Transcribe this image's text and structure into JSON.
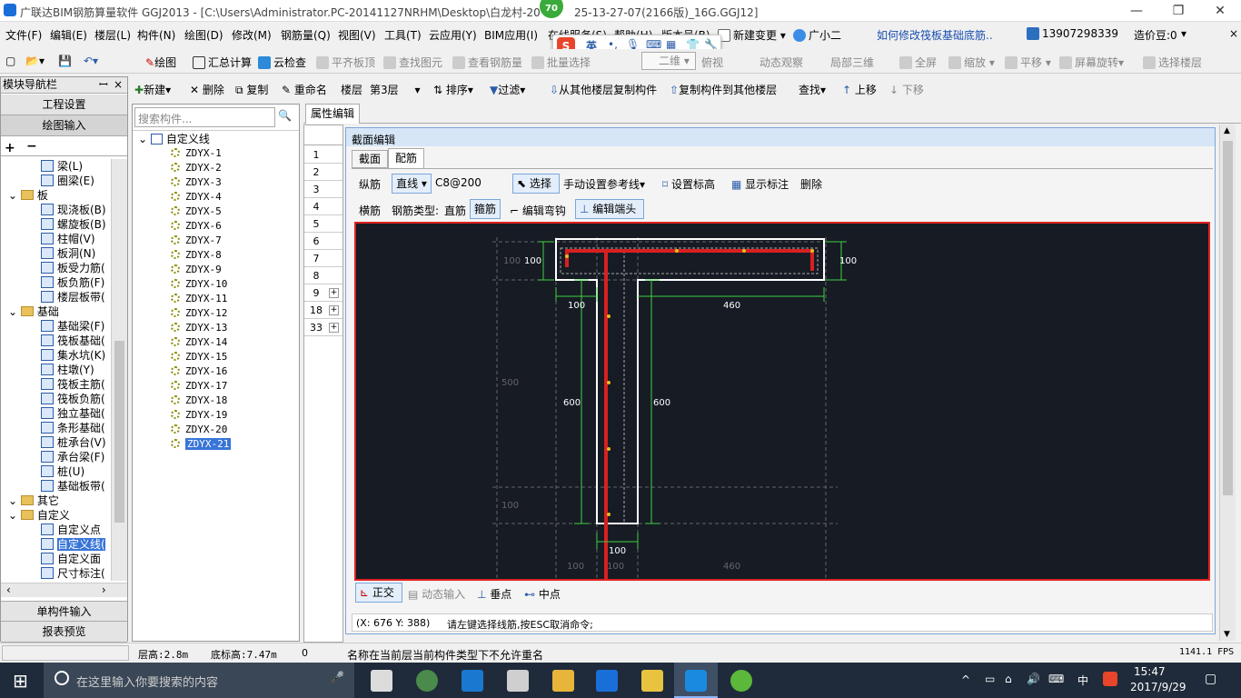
{
  "window": {
    "title": "广联达BIM钢筋算量软件 GGJ2013 - [C:\\Users\\Administrator.PC-20141127NRHM\\Desktop\\白龙村-20",
    "title_tail": "25-13-27-07(2166版)_16G.GGJ12]",
    "badge": "70"
  },
  "menu": [
    "文件(F)",
    "编辑(E)",
    "楼层(L)",
    "构件(N)",
    "绘图(D)",
    "修改(M)",
    "钢筋量(Q)",
    "视图(V)",
    "工具(T)",
    "云应用(Y)",
    "BIM应用(I)",
    "在线服务(S)",
    "帮助(H)",
    "版本号(B)",
    "新建变更",
    "广小二",
    "如何修改筏板基础底筋..",
    "13907298339",
    "造价豆:0"
  ],
  "toolbar": {
    "draw": "绘图",
    "sum": "汇总计算",
    "cloud_check": "云检查",
    "flat_top": "平齐板顶",
    "find_elem": "查找图元",
    "view_rebar": "查看钢筋量",
    "batch_select": "批量选择",
    "view_mode": "二维",
    "top_view": "俯视",
    "dynamic_view": "动态观察",
    "local_3d": "局部三维",
    "fullscreen": "全屏",
    "zoom": "缩放",
    "pan": "平移",
    "rotate": "屏幕旋转",
    "select_floor": "选择楼层"
  },
  "nav": {
    "title": "模块导航栏",
    "pin": "ᅟ",
    "close": "×",
    "btn_project": "工程设置",
    "btn_draw": "绘图输入",
    "btn_single": "单构件输入",
    "btn_report": "报表预览",
    "tree": [
      {
        "label": "梁(L)",
        "lvl": 2
      },
      {
        "label": "圈梁(E)",
        "lvl": 2
      },
      {
        "label": "板",
        "lvl": 1,
        "folder": true
      },
      {
        "label": "现浇板(B)",
        "lvl": 2
      },
      {
        "label": "螺旋板(B)",
        "lvl": 2
      },
      {
        "label": "柱帽(V)",
        "lvl": 2
      },
      {
        "label": "板洞(N)",
        "lvl": 2
      },
      {
        "label": "板受力筋(",
        "lvl": 2
      },
      {
        "label": "板负筋(F)",
        "lvl": 2
      },
      {
        "label": "楼层板带(",
        "lvl": 2
      },
      {
        "label": "基础",
        "lvl": 1,
        "folder": true
      },
      {
        "label": "基础梁(F)",
        "lvl": 2
      },
      {
        "label": "筏板基础(",
        "lvl": 2
      },
      {
        "label": "集水坑(K)",
        "lvl": 2
      },
      {
        "label": "柱墩(Y)",
        "lvl": 2
      },
      {
        "label": "筏板主筋(",
        "lvl": 2
      },
      {
        "label": "筏板负筋(",
        "lvl": 2
      },
      {
        "label": "独立基础(",
        "lvl": 2
      },
      {
        "label": "条形基础(",
        "lvl": 2
      },
      {
        "label": "桩承台(V)",
        "lvl": 2
      },
      {
        "label": "承台梁(F)",
        "lvl": 2
      },
      {
        "label": "桩(U)",
        "lvl": 2
      },
      {
        "label": "基础板带(",
        "lvl": 2
      },
      {
        "label": "其它",
        "lvl": 1,
        "folder": true
      },
      {
        "label": "自定义",
        "lvl": 1,
        "folder": true
      },
      {
        "label": "自定义点",
        "lvl": 2
      },
      {
        "label": "自定义线(",
        "lvl": 2,
        "selected": true
      },
      {
        "label": "自定义面",
        "lvl": 2
      },
      {
        "label": "尺寸标注(",
        "lvl": 2
      }
    ]
  },
  "comp_toolbar": {
    "new": "新建",
    "delete": "删除",
    "copy": "复制",
    "rename": "重命名",
    "floor_label": "楼层",
    "floor": "第3层",
    "sort": "排序",
    "filter": "过滤",
    "copy_from": "从其他楼层复制构件",
    "copy_to": "复制构件到其他楼层",
    "find": "查找",
    "up": "上移",
    "down": "下移"
  },
  "search": {
    "placeholder": "搜索构件..."
  },
  "components": {
    "root": "自定义线",
    "items": [
      "ZDYX-1",
      "ZDYX-2",
      "ZDYX-3",
      "ZDYX-4",
      "ZDYX-5",
      "ZDYX-6",
      "ZDYX-7",
      "ZDYX-8",
      "ZDYX-9",
      "ZDYX-10",
      "ZDYX-11",
      "ZDYX-12",
      "ZDYX-13",
      "ZDYX-14",
      "ZDYX-15",
      "ZDYX-16",
      "ZDYX-17",
      "ZDYX-18",
      "ZDYX-19",
      "ZDYX-20",
      "ZDYX-21"
    ],
    "selected": "ZDYX-21"
  },
  "prop_tab": "属性编辑",
  "rows": [
    "1",
    "2",
    "3",
    "4",
    "5",
    "6",
    "7",
    "8",
    "9",
    "18",
    "33"
  ],
  "dialog": {
    "title": "截面编辑",
    "tab1": "截面",
    "tab2": "配筋",
    "row1": {
      "longbar": "纵筋",
      "line": "直线",
      "spec": "C8@200",
      "select": "选择",
      "manual_ref": "手动设置参考线",
      "set_elev": "设置标高",
      "show_dim": "显示标注",
      "delete": "删除"
    },
    "row2": {
      "horbar": "横筋",
      "type_label": "钢筋类型:",
      "type_straight": "直筋",
      "type_stirrup": "箍筋",
      "edit_hook": "编辑弯钩",
      "edit_end": "编辑端头"
    },
    "bottom": {
      "ortho": "正交",
      "dyn_input": "动态输入",
      "perp": "垂点",
      "mid": "中点"
    },
    "coord": "(X: 676 Y: 388)",
    "hint": "请左键选择线筋,按ESC取消命令;"
  },
  "drawing": {
    "labels": [
      "100",
      "100",
      "100",
      "460",
      "500",
      "600",
      "600",
      "100",
      "100",
      "100",
      "100",
      "460"
    ]
  },
  "statusbar": {
    "floor_h": "层高:2.8m",
    "base_h": "底标高:7.47m",
    "zero": "0",
    "msg": "名称在当前层当前构件类型下不允许重名",
    "fps": "1141.1 FPS"
  },
  "taskbar": {
    "search": "在这里输入你要搜索的内容",
    "ime": "中",
    "time": "15:47",
    "date": "2017/9/29"
  },
  "ime_bar": {
    "text": "英"
  }
}
